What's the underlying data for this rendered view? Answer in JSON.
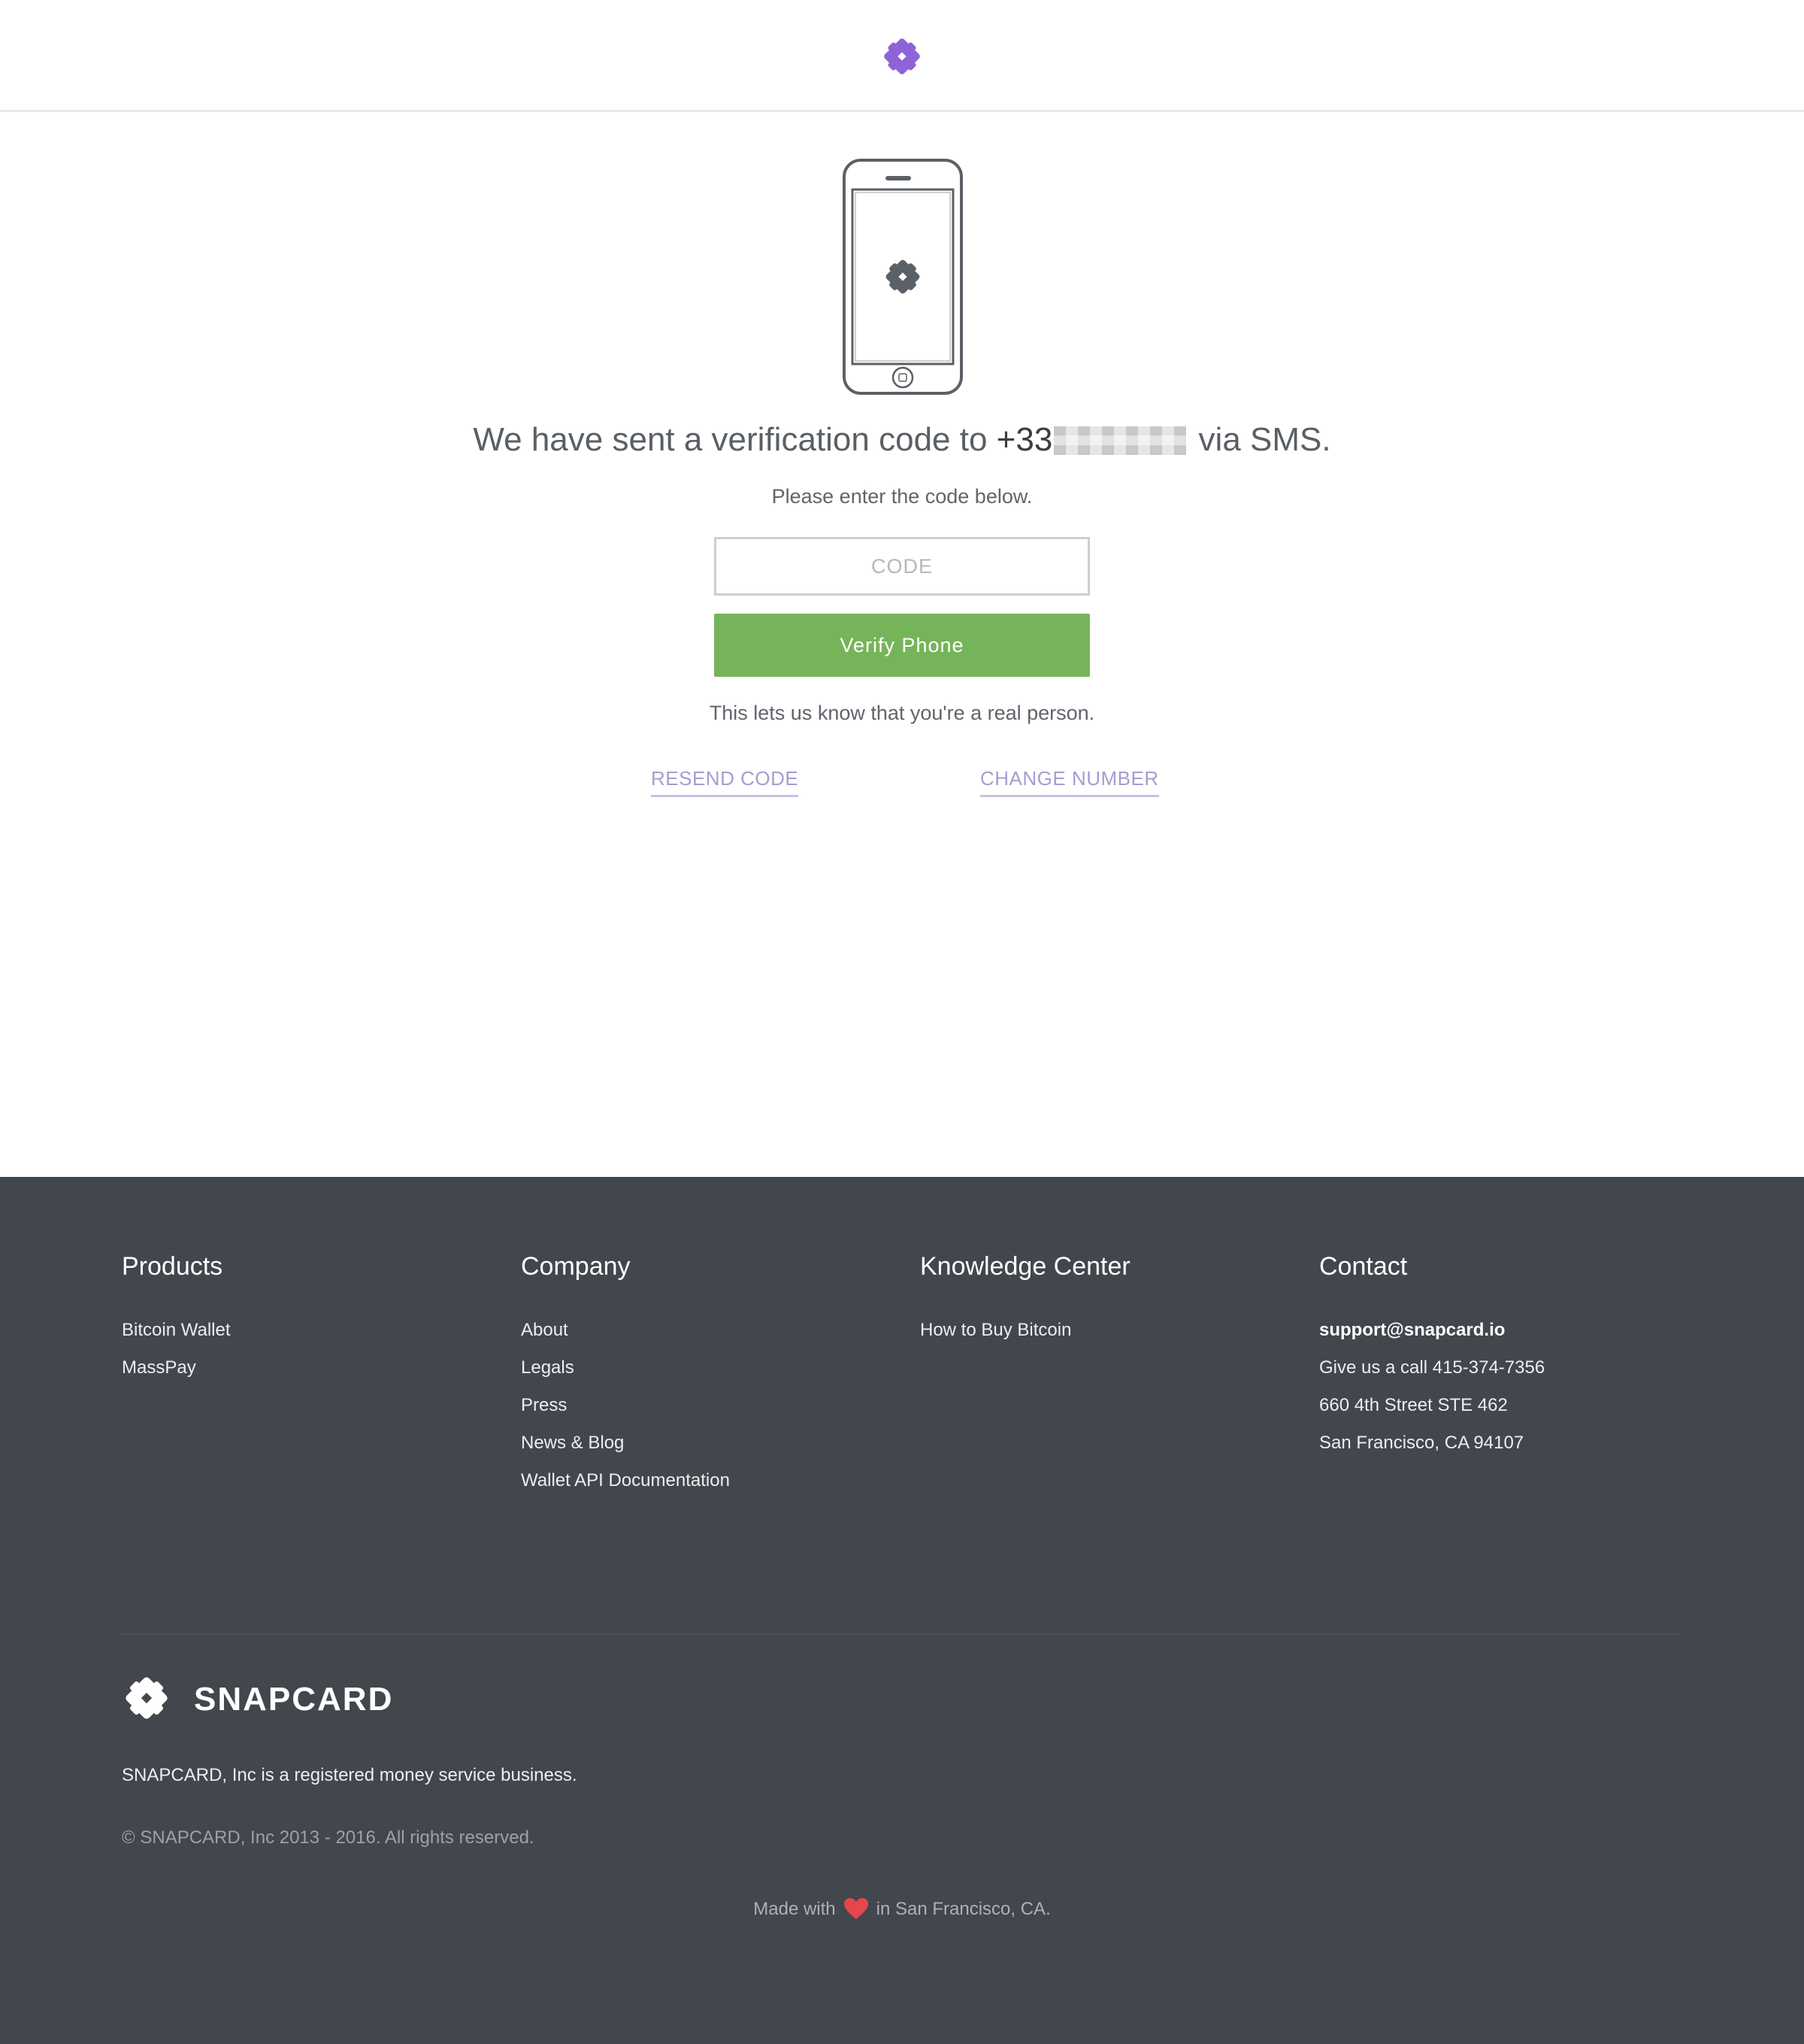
{
  "header": {
    "logo_icon": "snapcard-logo-icon",
    "accent_color": "#8e63d8"
  },
  "main": {
    "illustration_icon": "phone-icon",
    "headline_prefix": "We have sent a verification code to",
    "phone_visible": "+33",
    "headline_suffix": "via SMS.",
    "subhead": "Please enter the code below.",
    "code_input": {
      "placeholder": "CODE",
      "value": ""
    },
    "verify_label": "Verify Phone",
    "note": "This lets us know that you're a real person.",
    "resend_label": "RESEND CODE",
    "change_label": "CHANGE NUMBER",
    "button_color": "#76b45a",
    "link_color": "#a99bd0"
  },
  "footer": {
    "background": "#42464d",
    "columns": [
      {
        "title": "Products",
        "items": [
          "Bitcoin Wallet",
          "MassPay"
        ]
      },
      {
        "title": "Company",
        "items": [
          "About",
          "Legals",
          "Press",
          "News & Blog",
          "Wallet API Documentation"
        ]
      },
      {
        "title": "Knowledge Center",
        "items": [
          "How to Buy Bitcoin"
        ]
      },
      {
        "title": "Contact",
        "items": [
          "support@snapcard.io",
          "Give us a call 415-374-7356",
          "660 4th Street STE 462",
          "San Francisco, CA 94107"
        ]
      }
    ],
    "brand_name": "SNAPCARD",
    "registered": "SNAPCARD, Inc is a registered money service business.",
    "copyright": "© SNAPCARD, Inc 2013 - 2016. All rights reserved.",
    "made_with_prefix": "Made with",
    "made_with_suffix": "in San Francisco, CA.",
    "heart_icon": "heart-icon",
    "heart_color": "#e5474d"
  }
}
